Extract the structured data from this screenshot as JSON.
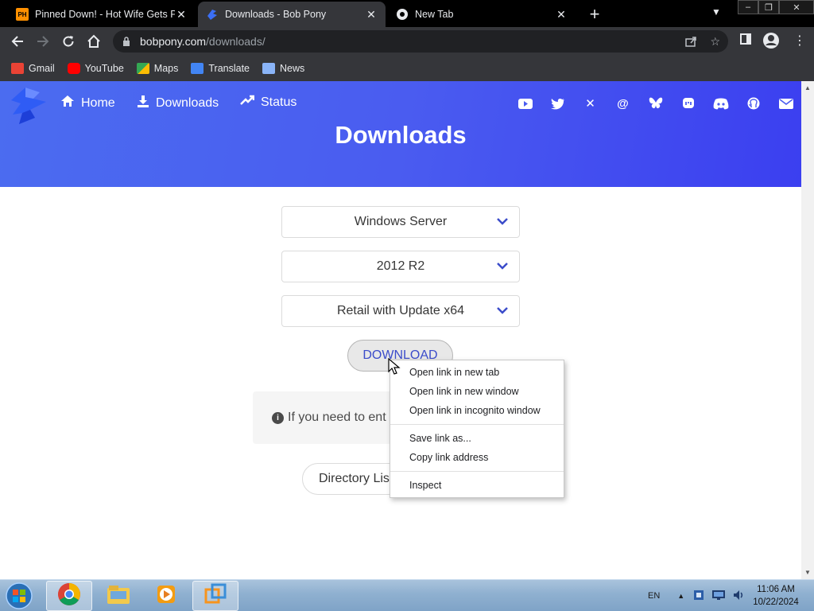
{
  "browser": {
    "tabs": [
      {
        "title": "Pinned Down! - Hot Wife Gets Po",
        "favicon_text": "PH",
        "active": false
      },
      {
        "title": "Downloads - Bob Pony",
        "active": true
      },
      {
        "title": "New Tab",
        "active": false
      }
    ],
    "address": {
      "domain": "bobpony.com",
      "path": "/downloads/"
    },
    "bookmarks": [
      {
        "label": "Gmail",
        "icon": "gmail-icon",
        "color": "#ea4335"
      },
      {
        "label": "YouTube",
        "icon": "youtube-icon",
        "color": "#ff0000"
      },
      {
        "label": "Maps",
        "icon": "maps-icon",
        "color": "#34a853"
      },
      {
        "label": "Translate",
        "icon": "translate-icon",
        "color": "#4285f4"
      },
      {
        "label": "News",
        "icon": "news-icon",
        "color": "#8ab4f8"
      }
    ]
  },
  "site": {
    "nav": [
      {
        "label": "Home",
        "icon": "home-icon"
      },
      {
        "label": "Downloads",
        "icon": "download-icon"
      },
      {
        "label": "Status",
        "icon": "trend-icon"
      }
    ],
    "socials": [
      "youtube-icon",
      "twitter-icon",
      "x-icon",
      "threads-icon",
      "bluesky-icon",
      "mastodon-icon",
      "discord-icon",
      "github-icon",
      "mail-icon"
    ],
    "hero_title": "Downloads",
    "accent": "#3b4cca",
    "selects": [
      "Windows Server",
      "2012 R2",
      "Retail with Update x64"
    ],
    "download_label": "DOWNLOAD",
    "info_text": "If you need to ent",
    "directory_label": "Directory Lis"
  },
  "context_menu": {
    "groups": [
      [
        "Open link in new tab",
        "Open link in new window",
        "Open link in incognito window"
      ],
      [
        "Save link as...",
        "Copy link address"
      ],
      [
        "Inspect"
      ]
    ]
  },
  "taskbar": {
    "apps": [
      "chrome-icon",
      "explorer-icon",
      "media-player-icon",
      "vmware-icon"
    ],
    "language": "EN",
    "time": "11:06 AM",
    "date": "10/22/2024"
  }
}
